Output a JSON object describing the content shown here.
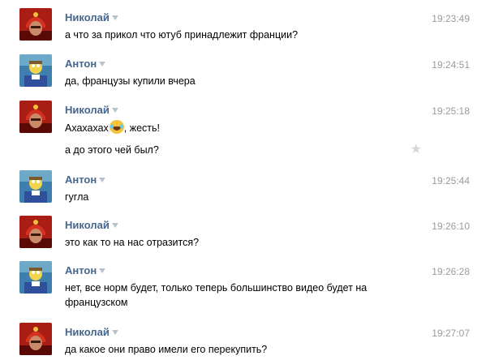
{
  "icons": {
    "user_menu": "chevron-down-icon",
    "favorite": "star-icon",
    "emoji_laugh": "laughing-crying-face"
  },
  "colors": {
    "name": "#45668e",
    "time": "#9b9b9b",
    "text": "#000000",
    "star": "#d6d6d6"
  },
  "messages": [
    {
      "author": "Николай",
      "time": "19:23:49",
      "text": "а что за прикол что ютуб принадлежит франции?"
    },
    {
      "author": "Антон",
      "time": "19:24:51",
      "text": "да, французы купили вчера"
    },
    {
      "author": "Николай",
      "time": "19:25:18",
      "text_a": "Ахахахах",
      "text_b": ", жесть!",
      "text2": "а до этого чей был?"
    },
    {
      "author": "Антон",
      "time": "19:25:44",
      "text": "гугла"
    },
    {
      "author": "Николай",
      "time": "19:26:10",
      "text": "это как то на нас отразится?"
    },
    {
      "author": "Антон",
      "time": "19:26:28",
      "text": "нет, все норм будет, только теперь большинство видео будет на французском"
    },
    {
      "author": "Николай",
      "time": "19:27:07",
      "text": "да какое они право имели его перекупить?"
    }
  ]
}
